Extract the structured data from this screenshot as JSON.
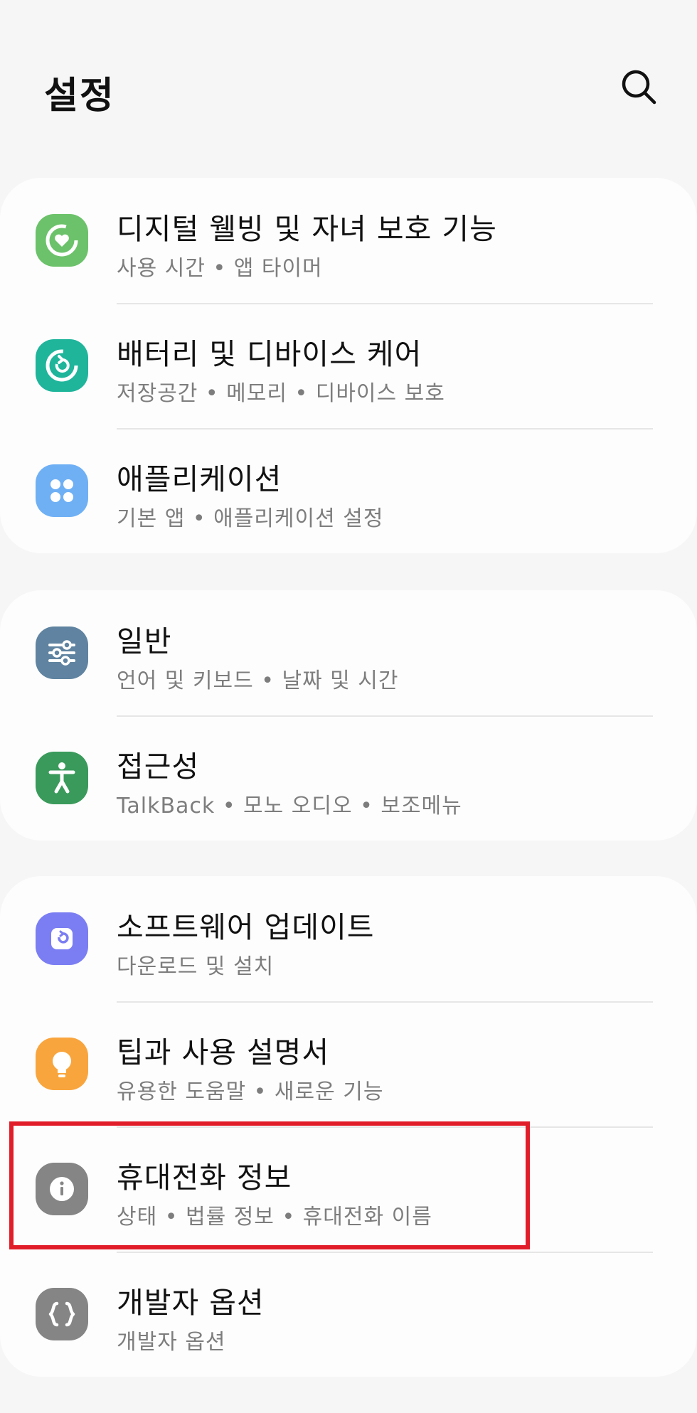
{
  "header": {
    "title": "설정",
    "search_icon": "search-icon"
  },
  "groups": [
    {
      "items": [
        {
          "title": "디지털 웰빙 및 자녀 보호 기능",
          "subtitle": "사용 시간 • 앱 타이머",
          "icon": "digital-wellbeing-icon",
          "color": "#6cc26a"
        },
        {
          "title": "배터리 및 디바이스 케어",
          "subtitle": "저장공간 • 메모리 • 디바이스 보호",
          "icon": "device-care-icon",
          "color": "#1eb59b"
        },
        {
          "title": "애플리케이션",
          "subtitle": "기본 앱 • 애플리케이션 설정",
          "icon": "apps-icon",
          "color": "#6fb0f5"
        }
      ]
    },
    {
      "items": [
        {
          "title": "일반",
          "subtitle": "언어 및 키보드 • 날짜 및 시간",
          "icon": "general-management-icon",
          "color": "#5f83a0"
        },
        {
          "title": "접근성",
          "subtitle": "TalkBack • 모노 오디오 • 보조메뉴",
          "icon": "accessibility-icon",
          "color": "#3a9a5b"
        }
      ]
    },
    {
      "items": [
        {
          "title": "소프트웨어 업데이트",
          "subtitle": "다운로드 및 설치",
          "icon": "software-update-icon",
          "color": "#7b7ef2"
        },
        {
          "title": "팁과 사용 설명서",
          "subtitle": "유용한 도움말 • 새로운 기능",
          "icon": "tips-lightbulb-icon",
          "color": "#f9a53d"
        },
        {
          "title": "휴대전화 정보",
          "subtitle": "상태 • 법률 정보 • 휴대전화 이름",
          "icon": "info-icon",
          "color": "#858585"
        },
        {
          "title": "개발자 옵션",
          "subtitle": "개발자 옵션",
          "icon": "developer-options-icon",
          "color": "#858585"
        }
      ]
    }
  ],
  "highlight": {
    "target": "휴대전화 정보",
    "color": "#e11d2a"
  }
}
